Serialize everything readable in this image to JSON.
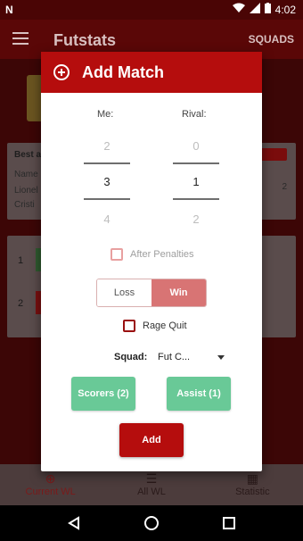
{
  "status_bar": {
    "notification_glyph": "N",
    "time": "4:02"
  },
  "app_bar": {
    "title": "Futstats",
    "action": "SQUADS"
  },
  "background": {
    "card_label": "Best a",
    "card_line1": "Name",
    "card_line2": "Lionel",
    "card_line3": "Cristi",
    "card_side": "2",
    "list_numbers": [
      "1",
      "2"
    ]
  },
  "bottom_nav": [
    {
      "label": "Current WL",
      "icon": "plus-circle-icon"
    },
    {
      "label": "All WL",
      "icon": "list-icon"
    },
    {
      "label": "Statistic",
      "icon": "chart-icon"
    }
  ],
  "dialog": {
    "title": "Add Match",
    "me_label": "Me:",
    "rival_label": "Rival:",
    "me_picker": {
      "above": "2",
      "selected": "3",
      "below": "4"
    },
    "rival_picker": {
      "above": "0",
      "selected": "1",
      "below": "2"
    },
    "after_penalties_label": "After Penalties",
    "loss_label": "Loss",
    "win_label": "Win",
    "rage_quit_label": "Rage Quit",
    "squad_label": "Squad:",
    "squad_value": "Fut C...",
    "scorers_label": "Scorers (2)",
    "assist_label": "Assist (1)",
    "add_label": "Add"
  },
  "colors": {
    "primary": "#b50d0d",
    "win": "#d87474",
    "green": "#69c997"
  }
}
